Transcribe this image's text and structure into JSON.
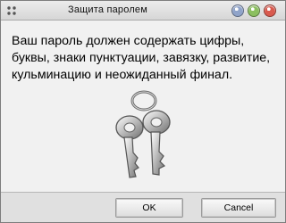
{
  "window": {
    "title": "Защита паролем"
  },
  "dialog": {
    "message": "Ваш пароль должен содержать цифры, буквы, знаки пунктуации, завязку, развитие, кульминацию и неожиданный финал."
  },
  "buttons": {
    "ok_label": "OK",
    "cancel_label": "Cancel"
  },
  "icons": {
    "window_menu": "window-menu-icon",
    "minimize": "minimize-icon",
    "maximize": "maximize-icon",
    "close": "close-icon",
    "keys": "keys-icon"
  },
  "colors": {
    "minimize": "#8fa3c9",
    "maximize": "#8bbf5f",
    "close": "#d95a4e"
  }
}
